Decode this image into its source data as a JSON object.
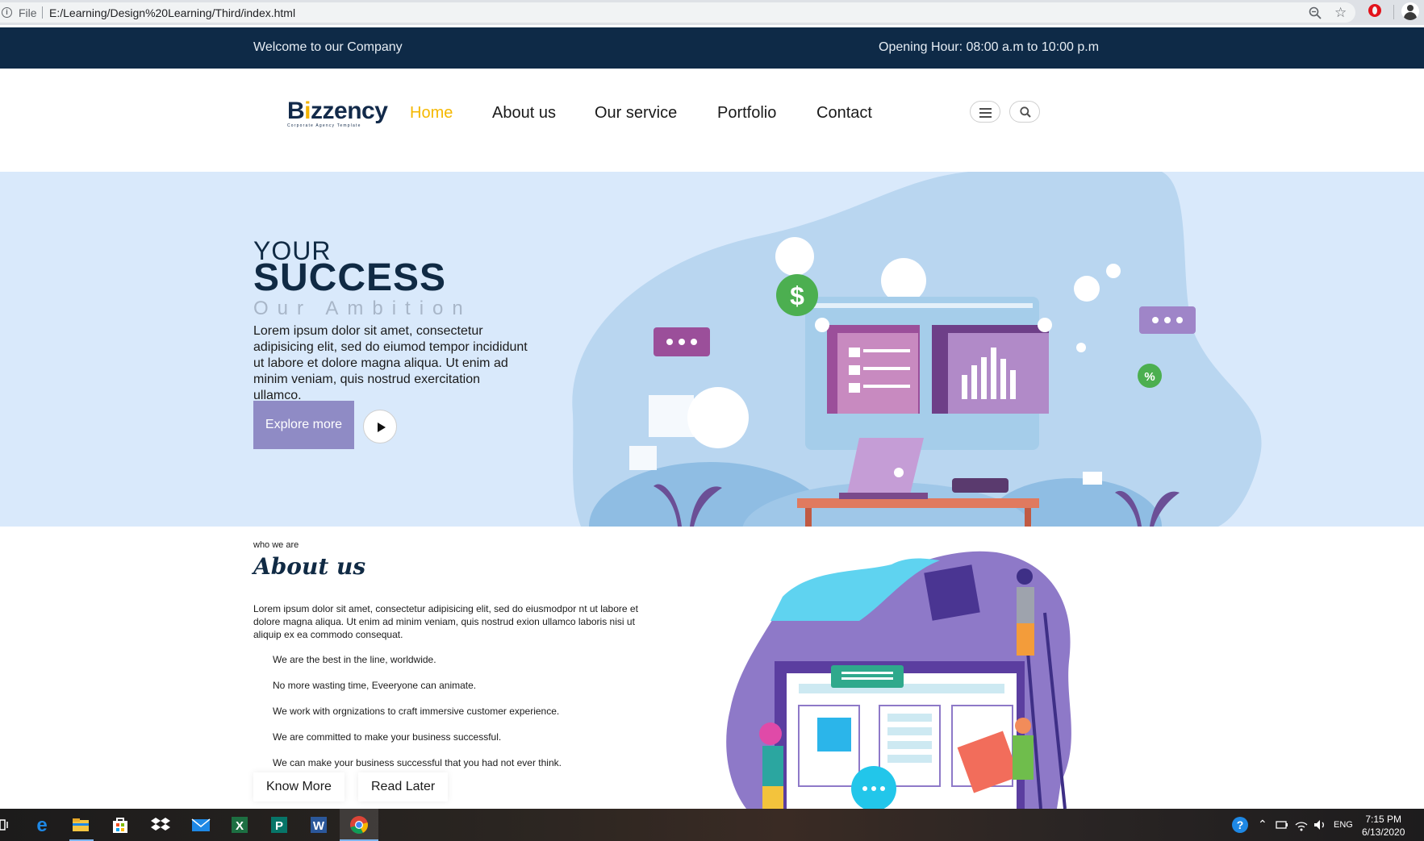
{
  "browser": {
    "file_label": "File",
    "url": "E:/Learning/Design%20Learning/Third/index.html",
    "info_icon": "info-icon",
    "zoom_icon": "zoom-out-icon",
    "star_icon": "bookmark-star-icon",
    "opera_icon": "opera-icon",
    "profile_icon": "profile-avatar-icon"
  },
  "topbar": {
    "welcome": "Welcome to our Company",
    "hours": "Opening Hour: 08:00 a.m to 10:00 p.m"
  },
  "logo": {
    "brand_prefix": "B",
    "brand_i": "i",
    "brand_suffix": "zzency",
    "tagline": "Corporate Agency Template"
  },
  "nav": {
    "items": [
      {
        "label": "Home",
        "active": true
      },
      {
        "label": "About us",
        "active": false
      },
      {
        "label": "Our service",
        "active": false
      },
      {
        "label": "Portfolio",
        "active": false
      },
      {
        "label": "Contact",
        "active": false
      }
    ],
    "menu_icon": "hamburger-menu-icon",
    "search_icon": "search-icon"
  },
  "hero": {
    "line1": "YOUR",
    "line2": "SUCCESS",
    "line3": "Our Ambition",
    "text": "Lorem ipsum dolor sit amet, consectetur adipisicing elit, sed do eiumod tempor incididunt ut labore et dolore magna aliqua. Ut enim ad minim veniam, quis nostrud exercitation ullamco.",
    "cta": "Explore more",
    "play_icon": "play-icon",
    "accent": "#8f8bc5",
    "background": "#d9e9fb"
  },
  "about": {
    "eyebrow": "who we are",
    "title": "About us",
    "text": "Lorem ipsum dolor sit amet, consectetur adipisicing elit, sed do eiusmodpor nt ut labore et dolore magna aliqua. Ut enim ad minim veniam, quis nostrud exion ullamco laboris nisi ut aliquip ex ea commodo consequat.",
    "points": [
      "We are the best in the line, worldwide.",
      "No more wasting time, Eveeryone can animate.",
      "We work with orgnizations to craft immersive customer experience.",
      "We are committed to make your business successful.",
      "We can make your business successful that you had not ever think."
    ],
    "btn_know": "Know More",
    "btn_read": "Read Later"
  },
  "taskbar": {
    "lang": "ENG",
    "time": "7:15 PM",
    "date": "6/13/2020",
    "apps": [
      "task-view-icon",
      "edge-icon",
      "file-explorer-icon",
      "store-icon",
      "dropbox-icon",
      "mail-icon",
      "excel-icon",
      "publisher-icon",
      "word-icon",
      "chrome-icon"
    ]
  },
  "colors": {
    "navy": "#0e2a47",
    "nav_active": "#f5b800",
    "hero_bg": "#d9e9fb",
    "blob": "#b9d6f0",
    "purple": "#8e79c8"
  }
}
